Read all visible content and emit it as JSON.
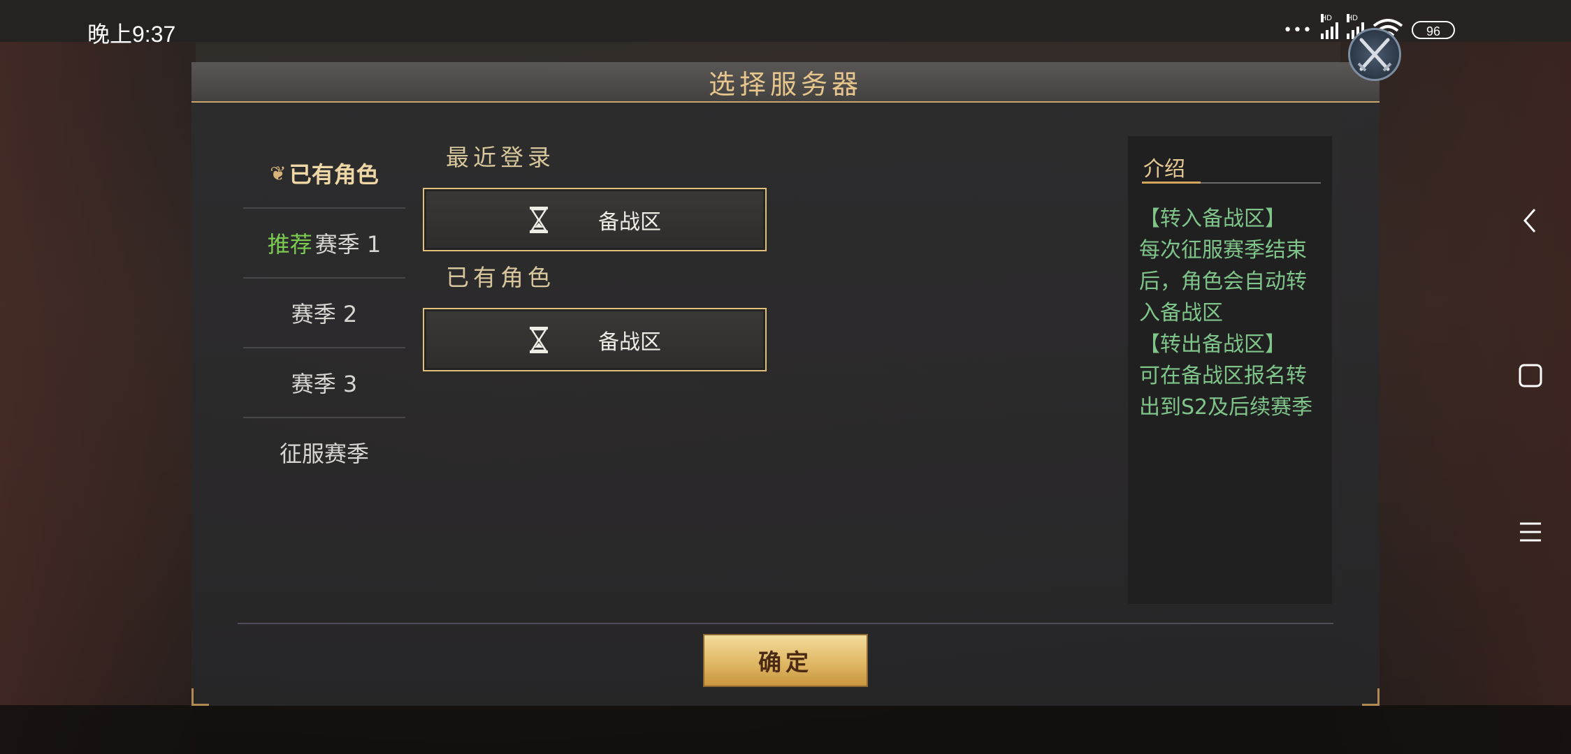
{
  "status_bar": {
    "time": "晚上9:37",
    "signal_label": "HD",
    "battery": "96",
    "dots": "•••"
  },
  "dialog": {
    "title": "选择服务器",
    "confirm_label": "确定"
  },
  "sidebar": {
    "items": [
      {
        "label": "已有角色",
        "tag": "",
        "active": true
      },
      {
        "label": "赛季 1",
        "tag": "推荐",
        "active": false
      },
      {
        "label": "赛季 2",
        "tag": "",
        "active": false
      },
      {
        "label": "赛季 3",
        "tag": "",
        "active": false
      },
      {
        "label": "征服赛季",
        "tag": "",
        "active": false
      }
    ]
  },
  "main": {
    "recent_label": "最近登录",
    "recent_server": "备战区",
    "existing_label": "已有角色",
    "existing_server": "备战区"
  },
  "intro": {
    "title": "介绍",
    "lines": [
      "【转入备战区】",
      "每次征服赛季结束",
      "后，角色会自动转",
      "入备战区",
      "【转出备战区】",
      "可在备战区报名转",
      "出到S2及后续赛季"
    ]
  },
  "colors": {
    "gold": "#e6c68c",
    "green_text": "#7fc58a",
    "recommend_green": "#7ccc52",
    "button_gold": "#e0b865"
  },
  "icons": {
    "close": "crossed-swords-close-icon",
    "server": "hourglass-icon",
    "active_item": "leaf-icon"
  }
}
